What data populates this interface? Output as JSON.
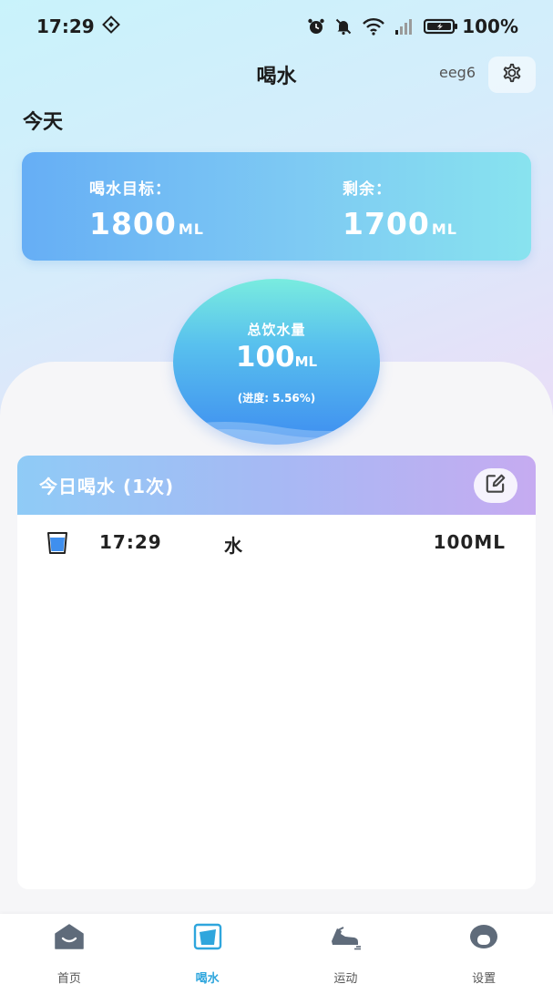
{
  "status_bar": {
    "time": "17:29",
    "battery": "100%"
  },
  "header": {
    "title": "喝水",
    "user": "eeg6"
  },
  "today": {
    "label": "今天"
  },
  "goal_card": {
    "goal_label": "喝水目标：",
    "goal_value": "1800",
    "remaining_label": "剩余：",
    "remaining_value": "1700",
    "unit": "ML"
  },
  "total": {
    "label": "总饮水量",
    "value": "100",
    "unit": "ML",
    "progress": "(进度: 5.56%)"
  },
  "records": {
    "title": "今日喝水 (1次)",
    "items": [
      {
        "time": "17:29",
        "drink": "水",
        "amount": "100ML"
      }
    ]
  },
  "nav": {
    "items": [
      {
        "label": "首页"
      },
      {
        "label": "喝水"
      },
      {
        "label": "运动"
      },
      {
        "label": "设置"
      }
    ]
  },
  "colors": {
    "accent": "#2fa6dd",
    "card_start": "#66aef5",
    "card_end": "#88e3ef"
  }
}
